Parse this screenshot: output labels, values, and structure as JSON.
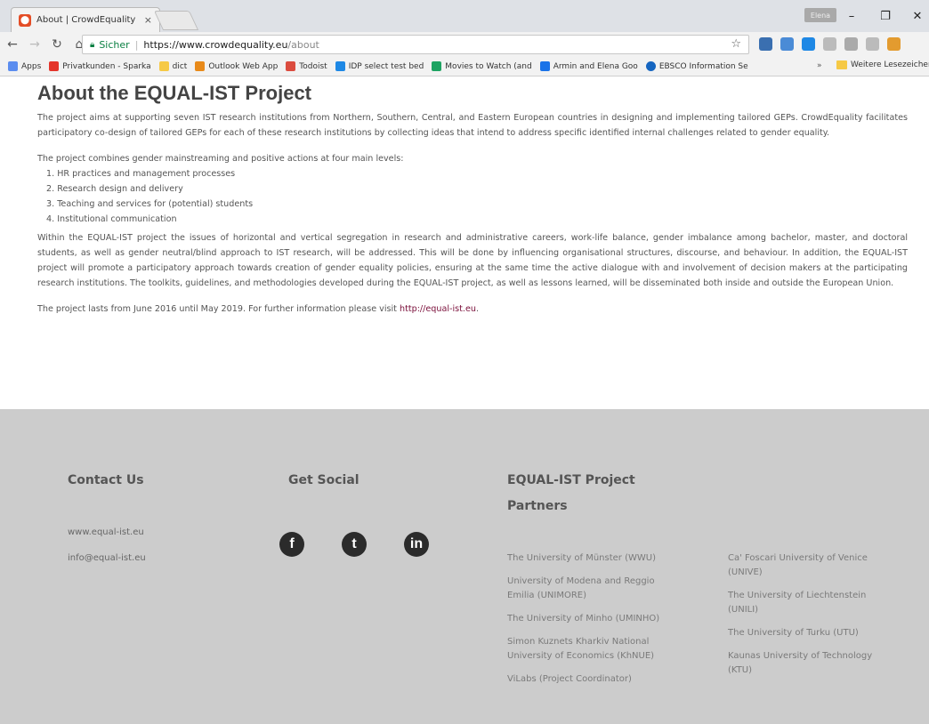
{
  "browser": {
    "tab_title": "About | CrowdEquality",
    "tab_close": "×",
    "profile_label": "Elena",
    "window_controls": [
      "–",
      "❐",
      "✕"
    ],
    "secure_label": "Sicher",
    "url_host": "https://www.crowdequality.eu",
    "url_path": "/about",
    "bookmarks": [
      {
        "label": "Apps",
        "color": "#5b8def"
      },
      {
        "label": "Privatkunden - Sparka",
        "color": "#e4352b"
      },
      {
        "label": "dict",
        "color": "#f6c945"
      },
      {
        "label": "Outlook Web App",
        "color": "#e88a1a"
      },
      {
        "label": "Todoist",
        "color": "#db4c3f"
      },
      {
        "label": "IDP select test bed",
        "color": "#1e88e5"
      },
      {
        "label": "Movies to Watch (and",
        "color": "#1ea362"
      },
      {
        "label": "Armin and Elena Goo",
        "color": "#1a73e8"
      },
      {
        "label": "EBSCO Information Se",
        "color": "#1565c0"
      }
    ],
    "bookmarks_more": "»",
    "bookmarks_other": "Weitere Lesezeichen"
  },
  "page": {
    "title": "About the EQUAL-IST Project",
    "intro": "The project aims at supporting seven IST research institutions from Northern, Southern, Central, and Eastern European countries in designing and implementing tailored GEPs. CrowdEquality facilitates participatory co-design of tailored GEPs for each of these research institutions by collecting ideas that intend to address specific identified internal challenges related to gender equality.",
    "levels_intro": "The project combines gender mainstreaming and positive actions at four main levels:",
    "levels": [
      "1. HR practices and management processes",
      "2. Research design and delivery",
      "3. Teaching and services for (potential) students",
      "4. Institutional communication"
    ],
    "body": "Within the EQUAL-IST project the issues of horizontal and vertical segregation in research and administrative careers, work-life balance, gender imbalance among bachelor, master, and doctoral students, as well as gender neutral/blind approach to IST research, will be addressed. This will be done by influencing organisational structures, discourse, and behaviour. In addition, the EQUAL-IST project will promote a participatory approach towards creation of gender equality policies, ensuring at the same time the active dialogue with and involvement of decision makers at the participating research institutions. The toolkits, guidelines, and methodologies developed during the EQUAL-IST project, as well as lessons learned, will be disseminated both inside and outside the European Union.",
    "duration_text": "The project lasts from June 2016 until May 2019. For further information please visit",
    "duration_link": "http://equal-ist.eu",
    "duration_end": "."
  },
  "footer": {
    "contact_title": "Contact Us",
    "contact_web": "www.equal-ist.eu",
    "contact_email": "info@equal-ist.eu",
    "social_title": "Get Social",
    "social": [
      "f",
      "t",
      "in"
    ],
    "partners_title_1": "EQUAL-IST Project",
    "partners_title_2": "Partners",
    "partners_left": [
      "The University of Münster (WWU)",
      "University of Modena and Reggio Emilia (UNIMORE)",
      "The University of Minho (UMINHO)",
      "Simon Kuznets Kharkiv National University of Economics (KhNUE)",
      "ViLabs (Project Coordinator)"
    ],
    "partners_right": [
      "Ca' Foscari University of Venice (UNIVE)",
      "The University of Liechtenstein (UNILI)",
      "The University of Turku (UTU)",
      "Kaunas University of Technology (KTU)"
    ]
  }
}
